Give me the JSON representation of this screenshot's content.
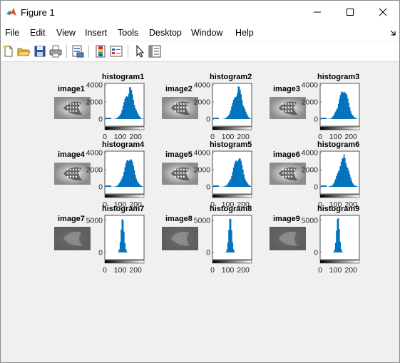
{
  "window": {
    "title": "Figure 1",
    "controls": {
      "minimize": "—",
      "maximize": "☐",
      "close": "✕"
    }
  },
  "menu": [
    "File",
    "Edit",
    "View",
    "Insert",
    "Tools",
    "Desktop",
    "Window",
    "Help"
  ],
  "toolbar": {
    "tools": [
      "new-figure-icon",
      "open-folder-icon",
      "save-icon",
      "print-icon",
      "print-preview-icon",
      "colorbar-icon",
      "legend-icon",
      "pointer-icon",
      "property-editor-icon"
    ]
  },
  "accent_color": "#0072bd",
  "subplots": [
    {
      "image_label": "image1",
      "hist_title": "histogram1",
      "ytick_labels": [
        "0",
        "2000",
        "4000"
      ],
      "xtick_labels": [
        "0",
        "100",
        "200"
      ]
    },
    {
      "image_label": "image2",
      "hist_title": "histogram2",
      "ytick_labels": [
        "0",
        "2000",
        "4000"
      ],
      "xtick_labels": [
        "0",
        "100",
        "200"
      ]
    },
    {
      "image_label": "image3",
      "hist_title": "histogram3",
      "ytick_labels": [
        "0",
        "2000",
        "4000"
      ],
      "xtick_labels": [
        "0",
        "100",
        "200"
      ]
    },
    {
      "image_label": "image4",
      "hist_title": "histogram4",
      "ytick_labels": [
        "0",
        "2000",
        "4000"
      ],
      "xtick_labels": [
        "0",
        "100",
        "200"
      ]
    },
    {
      "image_label": "image5",
      "hist_title": "histogram5",
      "ytick_labels": [
        "0",
        "2000",
        "4000"
      ],
      "xtick_labels": [
        "0",
        "100",
        "200"
      ]
    },
    {
      "image_label": "image6",
      "hist_title": "histogram6",
      "ytick_labels": [
        "0",
        "2000",
        "4000"
      ],
      "xtick_labels": [
        "0",
        "100",
        "200"
      ]
    },
    {
      "image_label": "image7",
      "hist_title": "histogram7",
      "ytick_labels": [
        "0",
        "5000"
      ],
      "xtick_labels": [
        "0",
        "100",
        "200"
      ]
    },
    {
      "image_label": "image8",
      "hist_title": "histogram8",
      "ytick_labels": [
        "0",
        "5000"
      ],
      "xtick_labels": [
        "0",
        "100",
        "200"
      ]
    },
    {
      "image_label": "image9",
      "hist_title": "histogram9",
      "ytick_labels": [
        "0",
        "5000"
      ],
      "xtick_labels": [
        "0",
        "100",
        "200"
      ]
    }
  ]
}
